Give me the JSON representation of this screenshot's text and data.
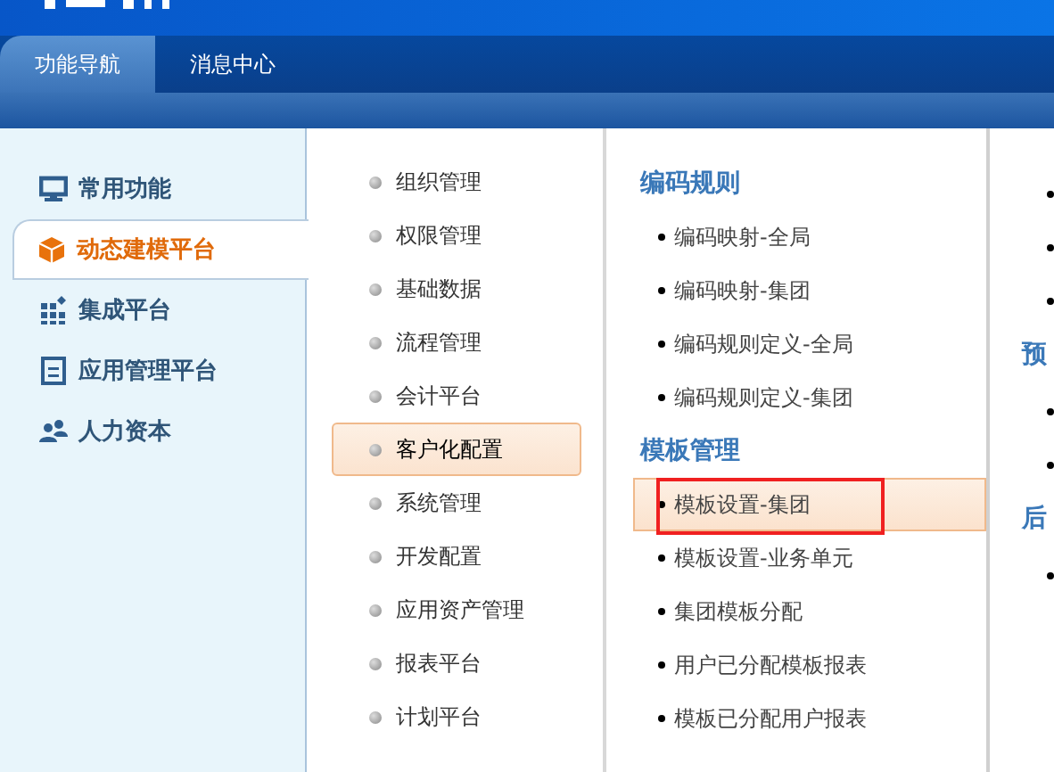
{
  "tabs": [
    {
      "label": "功能导航",
      "selected": true
    },
    {
      "label": "消息中心",
      "selected": false
    }
  ],
  "sidebar": {
    "items": [
      {
        "label": "常用功能",
        "kind": "monitor",
        "selected": false
      },
      {
        "label": "动态建模平台",
        "kind": "cube",
        "selected": true
      },
      {
        "label": "集成平台",
        "kind": "grid",
        "selected": false
      },
      {
        "label": "应用管理平台",
        "kind": "panel",
        "selected": false
      },
      {
        "label": "人力资本",
        "kind": "people",
        "selected": false
      }
    ]
  },
  "modules": [
    {
      "label": "组织管理",
      "selected": false
    },
    {
      "label": "权限管理",
      "selected": false
    },
    {
      "label": "基础数据",
      "selected": false
    },
    {
      "label": "流程管理",
      "selected": false
    },
    {
      "label": "会计平台",
      "selected": false
    },
    {
      "label": "客户化配置",
      "selected": true
    },
    {
      "label": "系统管理",
      "selected": false
    },
    {
      "label": "开发配置",
      "selected": false
    },
    {
      "label": "应用资产管理",
      "selected": false
    },
    {
      "label": "报表平台",
      "selected": false
    },
    {
      "label": "计划平台",
      "selected": false
    }
  ],
  "groups": [
    {
      "title": "编码规则",
      "items": [
        {
          "label": "编码映射-全局",
          "selected": false,
          "highlighted": false
        },
        {
          "label": "编码映射-集团",
          "selected": false,
          "highlighted": false
        },
        {
          "label": "编码规则定义-全局",
          "selected": false,
          "highlighted": false
        },
        {
          "label": "编码规则定义-集团",
          "selected": false,
          "highlighted": false
        }
      ]
    },
    {
      "title": "模板管理",
      "items": [
        {
          "label": "模板设置-集团",
          "selected": true,
          "highlighted": true
        },
        {
          "label": "模板设置-业务单元",
          "selected": false,
          "highlighted": false
        },
        {
          "label": "集团模板分配",
          "selected": false,
          "highlighted": false
        },
        {
          "label": "用户已分配模板报表",
          "selected": false,
          "highlighted": false
        },
        {
          "label": "模板已分配用户报表",
          "selected": false,
          "highlighted": false
        }
      ]
    }
  ],
  "column_4": [
    {
      "kind": "item"
    },
    {
      "kind": "item"
    },
    {
      "kind": "item"
    },
    {
      "kind": "heading",
      "label": "预"
    },
    {
      "kind": "item"
    },
    {
      "kind": "item"
    },
    {
      "kind": "heading",
      "label": "后"
    },
    {
      "kind": "item"
    }
  ]
}
